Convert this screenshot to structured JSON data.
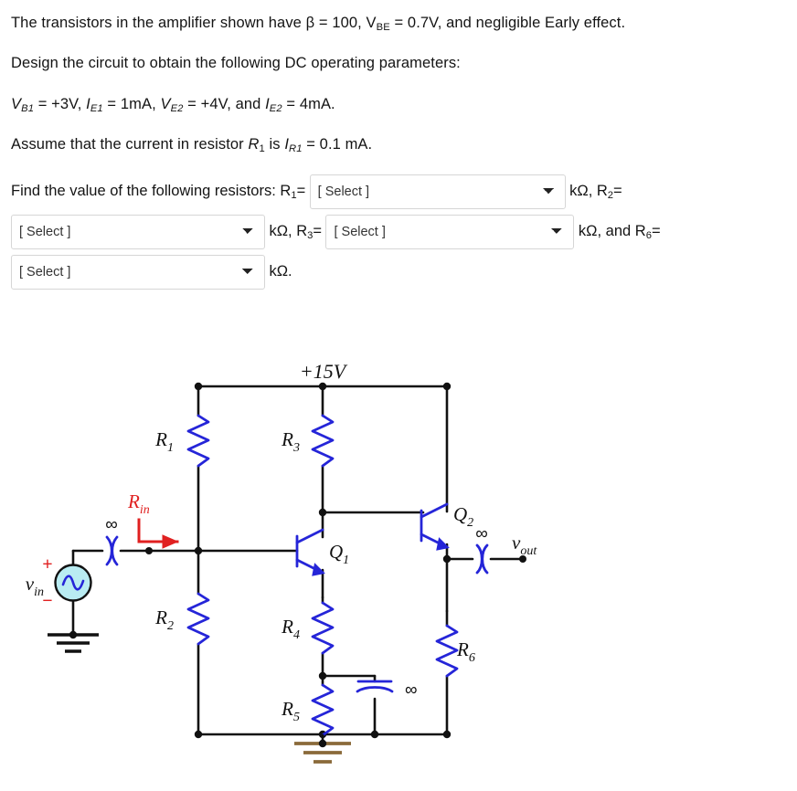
{
  "problem": {
    "line1_a": "The transistors in the amplifier shown have β = 100, V",
    "line1_sub": "BE",
    "line1_b": " = 0.7V, and negligible Early effect.",
    "line2": "Design the circuit to obtain the following DC operating parameters:",
    "line3_v1": "V",
    "line3_v1sub": "B1",
    "line3_t1": " = +3V, ",
    "line3_i1": "I",
    "line3_i1sub": "E1",
    "line3_t2": " = 1mA, ",
    "line3_v2": "V",
    "line3_v2sub": "E2",
    "line3_t3": " = +4V, and ",
    "line3_i2": "I",
    "line3_i2sub": "E2",
    "line3_t4": " = 4mA.",
    "line4_a": "Assume that the current in resistor ",
    "line4_r": "R",
    "line4_rsub": "1",
    "line4_b": " is ",
    "line4_i": "I",
    "line4_isub": "R1",
    "line4_c": " = 0.1 mA."
  },
  "question": {
    "lead": "Find the value of the following resistors: R",
    "lead_sub": "1",
    "lead_eq": "=",
    "after_r1": "kΩ, R",
    "after_r1_sub": "2",
    "after_r1_eq": "=",
    "after_r2": "kΩ, R",
    "after_r2_sub": "3",
    "after_r2_eq": "=",
    "after_r3": "kΩ, and R",
    "after_r3_sub": "6",
    "after_r3_eq": "=",
    "after_r6": "kΩ."
  },
  "dropdowns": [
    {
      "name": "r1-select",
      "value": "[ Select ]",
      "options": [
        "[ Select ]"
      ]
    },
    {
      "name": "r2-select",
      "value": "[ Select ]",
      "options": [
        "[ Select ]"
      ]
    },
    {
      "name": "r3-select",
      "value": "[ Select ]",
      "options": [
        "[ Select ]"
      ]
    },
    {
      "name": "r6-select",
      "value": "[ Select ]",
      "options": [
        "[ Select ]"
      ]
    }
  ],
  "circuit": {
    "supply_label": "+15V",
    "rin_label": "R",
    "rin_sub": "in",
    "vin_label": "v",
    "vin_sub": "in",
    "vout_label": "v",
    "vout_sub": "out",
    "plus_sign": "+",
    "minus_sign": "−",
    "infinity": "∞",
    "resistors": [
      {
        "name": "R1",
        "label": "R",
        "sub": "1"
      },
      {
        "name": "R2",
        "label": "R",
        "sub": "2"
      },
      {
        "name": "R3",
        "label": "R",
        "sub": "3"
      },
      {
        "name": "R4",
        "label": "R",
        "sub": "4"
      },
      {
        "name": "R5",
        "label": "R",
        "sub": "5"
      },
      {
        "name": "R6",
        "label": "R",
        "sub": "6"
      }
    ],
    "transistors": [
      {
        "name": "Q1",
        "label": "Q",
        "sub": "1"
      },
      {
        "name": "Q2",
        "label": "Q",
        "sub": "2"
      }
    ],
    "capacitors": [
      "∞",
      "∞",
      "∞"
    ],
    "colors": {
      "wire": "#111111",
      "component": "#2525d8",
      "accent_red": "#e02020",
      "source_fill": "#b9ecf2",
      "ground_brown": "#8a6a3a"
    }
  }
}
